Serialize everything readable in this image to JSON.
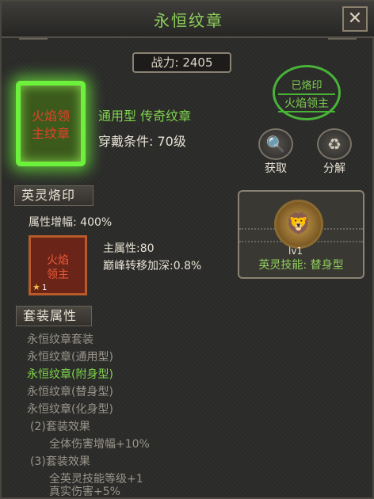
{
  "header": {
    "title": "永恒纹章",
    "close_label": "✕"
  },
  "power": {
    "text": "战力: 2405"
  },
  "emblem": {
    "line1": "火焰领",
    "line2": "主纹章"
  },
  "item": {
    "type": "通用型 传奇纹章",
    "requirement": "穿戴条件: 70级"
  },
  "stamp": {
    "line1": "已烙印",
    "line2": "火焰领主"
  },
  "actions": [
    {
      "label": "获取",
      "icon": "🔍"
    },
    {
      "label": "分解",
      "icon": "♻"
    }
  ],
  "spirit_brand": {
    "section_title": "英灵烙印",
    "attr_boost": "属性增幅: 400%",
    "card_line1": "火焰",
    "card_line2": "领主",
    "card_level": "1",
    "main_attr": "主属性:80",
    "peak": "巅峰转移加深:0.8%"
  },
  "spirit_panel": {
    "level": "lv1",
    "skill": "英灵技能: 替身型"
  },
  "set": {
    "section_title": "套装属性",
    "lines": [
      {
        "text": "永恒纹章套装"
      },
      {
        "text": "永恒纹章(通用型)"
      },
      {
        "text": "永恒纹章(附身型)"
      },
      {
        "text": "永恒纹章(替身型)"
      },
      {
        "text": "永恒纹章(化身型)"
      },
      {
        "text": "(2)套装效果"
      },
      {
        "text": "全体伤害增幅+10%"
      },
      {
        "text": "(3)套装效果"
      },
      {
        "text": "全英灵技能等级+1"
      },
      {
        "text": "真实伤害+5%"
      }
    ]
  }
}
